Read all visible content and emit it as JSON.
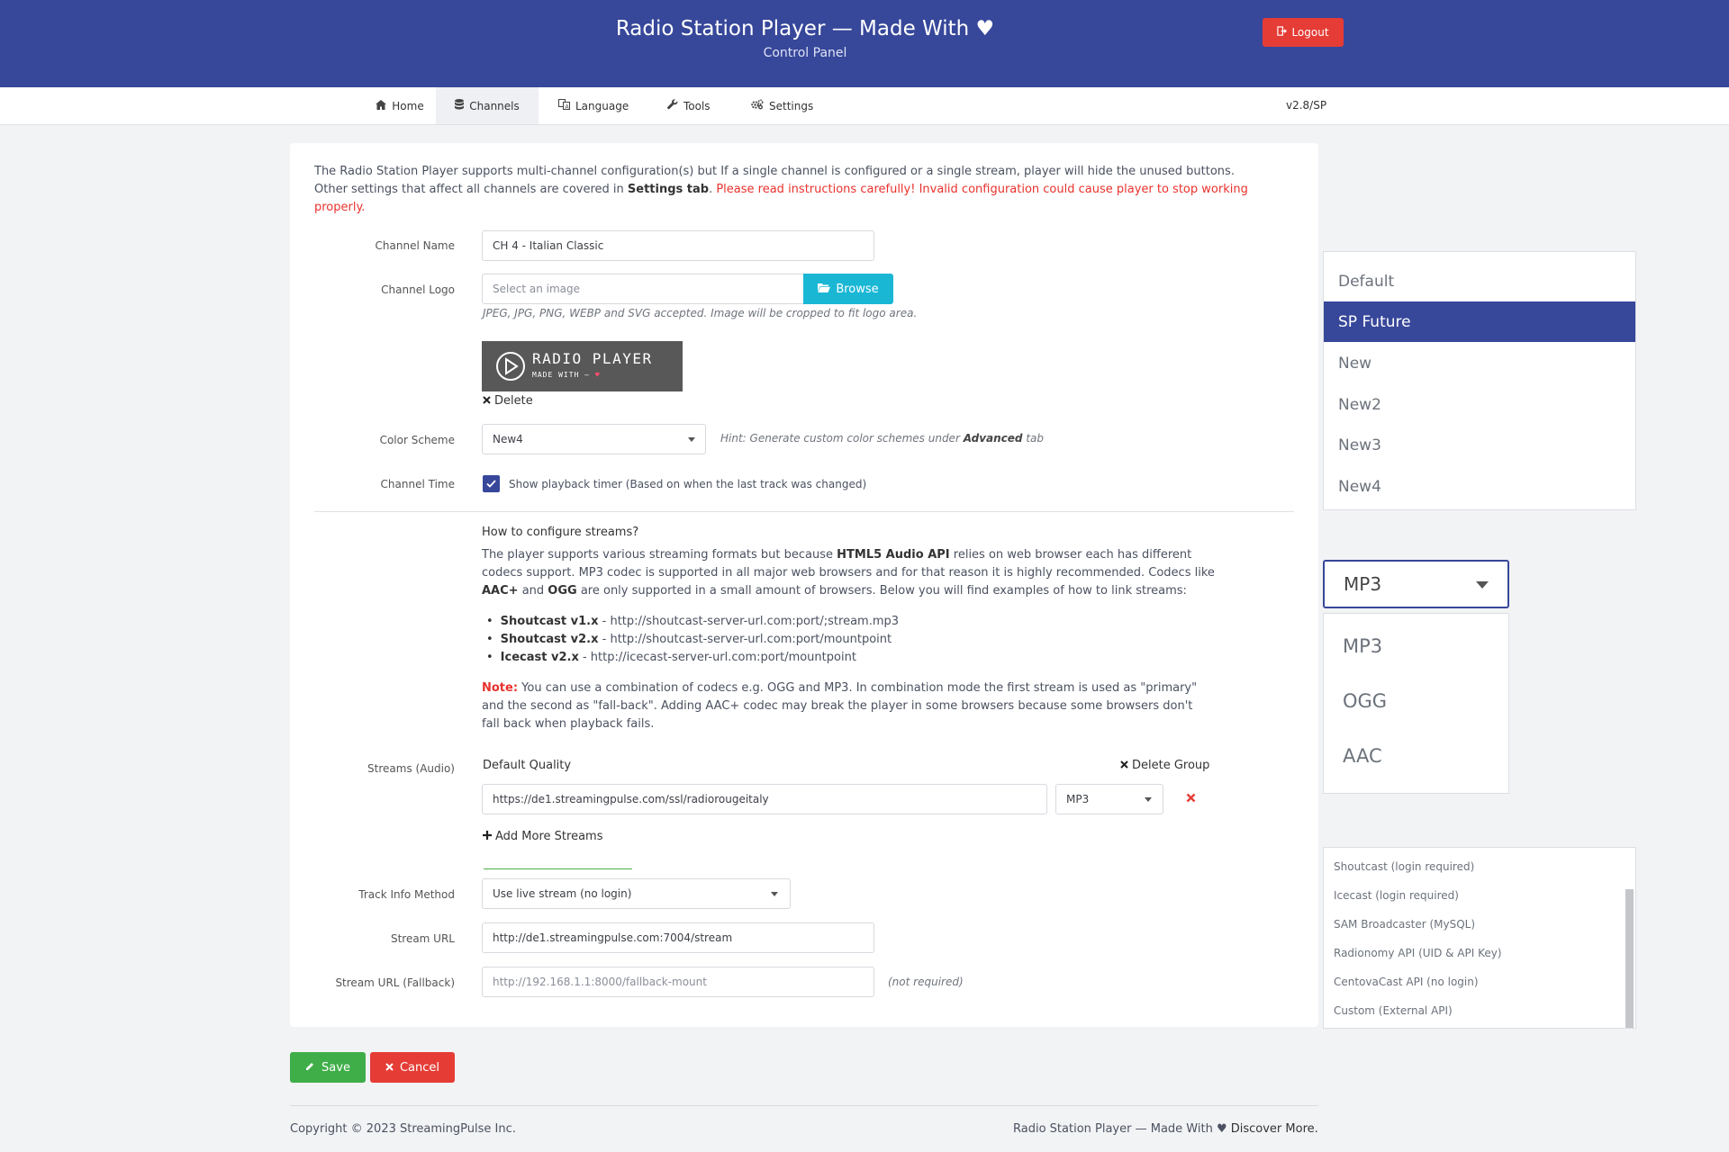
{
  "header": {
    "title": "Radio Station Player — Made With ♥",
    "subtitle": "Control Panel",
    "logout_label": "Logout"
  },
  "nav": {
    "items": [
      {
        "label": "Home",
        "icon": "home-icon"
      },
      {
        "label": "Channels",
        "icon": "database-icon",
        "active": true
      },
      {
        "label": "Language",
        "icon": "language-icon"
      },
      {
        "label": "Tools",
        "icon": "wrench-icon"
      },
      {
        "label": "Settings",
        "icon": "gears-icon"
      }
    ],
    "version": "v2.8/SP"
  },
  "intro": {
    "text1": "The Radio Station Player supports multi-channel configuration(s) but If a single channel is configured or a single stream, player will hide the unused buttons. Other settings that affect all channels are covered in ",
    "settings_tab": "Settings tab",
    "text2": ". ",
    "warning": "Please read instructions carefully! Invalid configuration could cause player to stop working properly."
  },
  "form": {
    "channel_name_label": "Channel Name",
    "channel_name_value": "CH 4 - Italian Classic",
    "channel_logo_label": "Channel Logo",
    "logo_placeholder": "Select an image",
    "browse_label": "Browse",
    "logo_help": "JPEG, JPG, PNG, WEBP and SVG accepted. Image will be cropped to fit logo area.",
    "logo_preview_title": "RADIO PLAYER",
    "logo_preview_sub": "MADE WITH —",
    "delete_label": "Delete",
    "color_scheme_label": "Color Scheme",
    "color_scheme_value": "New4",
    "color_hint_prefix": "Hint: Generate custom color schemes under ",
    "color_hint_bold": "Advanced",
    "color_hint_suffix": " tab",
    "channel_time_label": "Channel Time",
    "channel_time_checkbox": "Show playback timer (Based on when the last track was changed)",
    "channel_time_checked": true
  },
  "howto": {
    "title": "How to configure streams?",
    "p1_a": "The player supports various streaming formats but because ",
    "p1_b": "HTML5 Audio API",
    "p1_c": " relies on web browser each has different codecs support. MP3 codec is supported in all major web browsers and for that reason it is highly recommended. Codecs like ",
    "p1_d": "AAC+",
    "p1_e": " and ",
    "p1_f": "OGG",
    "p1_g": " are only supported in a small amount of browsers. Below you will find examples of how to link streams:",
    "bullets": [
      {
        "name": "Shoutcast v1.x",
        "url": " - http://shoutcast-server-url.com:port/;stream.mp3"
      },
      {
        "name": "Shoutcast v2.x",
        "url": " - http://shoutcast-server-url.com:port/mountpoint"
      },
      {
        "name": "Icecast v2.x",
        "url": " - http://icecast-server-url.com:port/mountpoint"
      }
    ],
    "note_label": "Note:",
    "note_text": " You can use a combination of codecs e.g. OGG and MP3. In combination mode the first stream is used as \"primary\" and the second as \"fall-back\". Adding AAC+ codec may break the player in some browsers because some browsers don't fall back when playback fails."
  },
  "streams": {
    "label": "Streams (Audio)",
    "group_title": "Default Quality",
    "delete_group": "Delete Group",
    "url": "https://de1.streamingpulse.com/ssl/radiorougeitaly",
    "codec": "MP3",
    "add_more": "Add More Streams"
  },
  "track": {
    "method_label": "Track Info Method",
    "method_value": "Use live stream (no login)",
    "stream_url_label": "Stream URL",
    "stream_url_value": "http://de1.streamingpulse.com:7004/stream",
    "fallback_label": "Stream URL (Fallback)",
    "fallback_placeholder": "http://192.168.1.1:8000/fallback-mount",
    "fallback_hint": "(not required)"
  },
  "actions": {
    "save": "Save",
    "cancel": "Cancel"
  },
  "footer": {
    "copyright": "Copyright © 2023 StreamingPulse Inc.",
    "right_text": "Radio Station Player — Made With ♥ ",
    "right_link": "Discover More."
  },
  "dropdown_color_scheme": {
    "options": [
      "Default",
      "SP Future",
      "New",
      "New2",
      "New3",
      "New4"
    ],
    "selected": "SP Future"
  },
  "dropdown_codec": {
    "selected": "MP3",
    "options": [
      "MP3",
      "OGG",
      "AAC"
    ]
  },
  "dropdown_track_method": {
    "options": [
      "Shoutcast (login required)",
      "Icecast (login required)",
      "SAM Broadcaster (MySQL)",
      "Radionomy API (UID & API Key)",
      "CentovaCast API (no login)",
      "Custom (External API)"
    ]
  },
  "colors": {
    "primary": "#37479a",
    "danger": "#e53c36",
    "info": "#1ab7d5",
    "success": "#3fae49"
  }
}
